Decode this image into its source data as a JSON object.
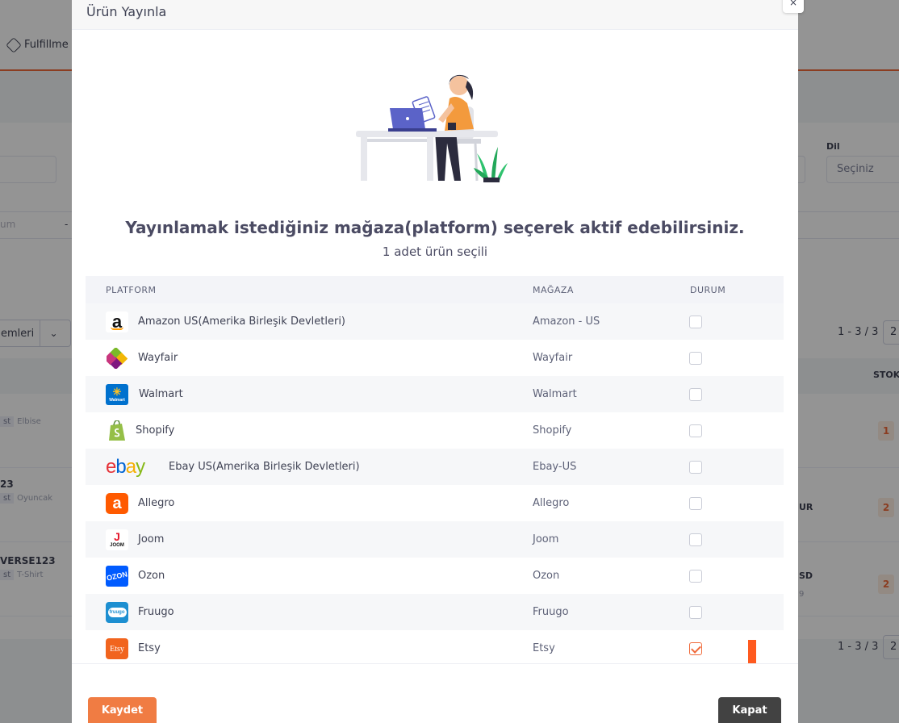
{
  "background": {
    "nav_item": "Fulfillme",
    "filter_label_lang": "Dil",
    "filter_lang_value": "Seçiniz",
    "strip_text": "um",
    "strip_dash": "-",
    "select_value": "emleri",
    "pager_text": "1 - 3 / 3",
    "pager_box": "2",
    "col_stock": "STOK",
    "rows": [
      {
        "code": "",
        "tag_type": "st",
        "tag": "Elbise",
        "stock": "1",
        "price": ""
      },
      {
        "code": "23",
        "tag_type": "st",
        "tag": "Oyuncak",
        "stock": "2",
        "price": "UR"
      },
      {
        "code": "VERSE123",
        "tag_type": "st",
        "tag": "T-Shirt",
        "stock": "2",
        "price": "SD"
      }
    ],
    "row3_extra": "9"
  },
  "modal": {
    "title": "Ürün Yayınla",
    "close_label": "×",
    "headline": "Yayınlamak istediğiniz mağaza(platform) seçerek aktif edebilirsiniz.",
    "subline": "1 adet ürün seçili",
    "columns": {
      "platform": "PLATFORM",
      "store": "MAĞAZA",
      "status": "DURUM"
    },
    "rows": [
      {
        "platform": "Amazon US(Amerika Birleşik Devletleri)",
        "store": "Amazon - US",
        "checked": false,
        "logo": "amazon-logo"
      },
      {
        "platform": "Wayfair",
        "store": "Wayfair",
        "checked": false,
        "logo": "wayfair-logo"
      },
      {
        "platform": "Walmart",
        "store": "Walmart",
        "checked": false,
        "logo": "walmart-logo"
      },
      {
        "platform": "Shopify",
        "store": "Shopify",
        "checked": false,
        "logo": "shopify-logo"
      },
      {
        "platform": "Ebay US(Amerika Birleşik Devletleri)",
        "store": "Ebay-US",
        "checked": false,
        "logo": "ebay-logo"
      },
      {
        "platform": "Allegro",
        "store": "Allegro",
        "checked": false,
        "logo": "allegro-logo"
      },
      {
        "platform": "Joom",
        "store": "Joom",
        "checked": false,
        "logo": "joom-logo"
      },
      {
        "platform": "Ozon",
        "store": "Ozon",
        "checked": false,
        "logo": "ozon-logo"
      },
      {
        "platform": "Fruugo",
        "store": "Fruugo",
        "checked": false,
        "logo": "fruugo-logo"
      },
      {
        "platform": "Etsy",
        "store": "Etsy",
        "checked": true,
        "logo": "etsy-logo"
      }
    ],
    "logo_text": {
      "amazon": "a",
      "walmart": "✳",
      "walmart_sub": "Walmart",
      "ebay_e": "e",
      "ebay_b": "b",
      "ebay_a": "a",
      "ebay_y": "y",
      "allegro": "a",
      "joom": "J",
      "joom_sub": "JOOM",
      "ozon": "OZON",
      "fruugo": "fruugo",
      "etsy": "Etsy"
    },
    "save_label": "Kaydet",
    "close_button_label": "Kapat"
  },
  "colors": {
    "accent": "#f07c43",
    "dark_button": "#424242",
    "overlay": "rgba(0,0,0,0.42)"
  }
}
